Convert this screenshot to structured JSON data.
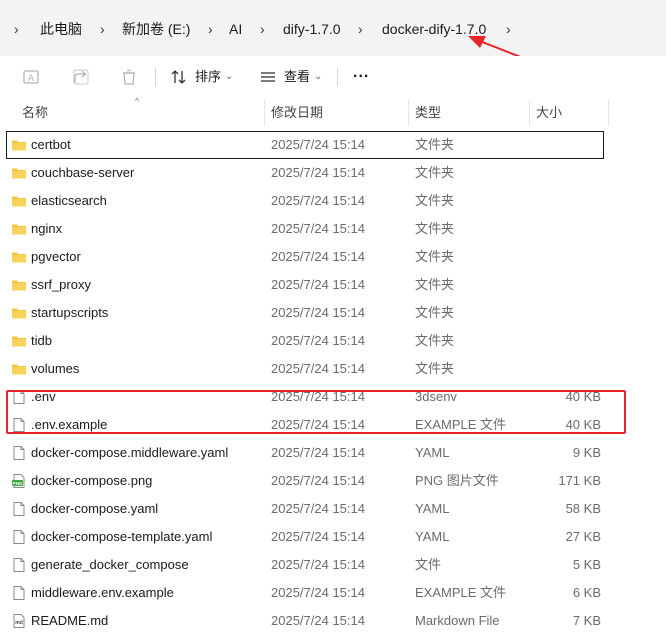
{
  "breadcrumb": {
    "items": [
      "此电脑",
      "新加卷 (E:)",
      "AI",
      "dify-1.7.0",
      "docker-dify-1.7.0"
    ]
  },
  "toolbar": {
    "sort_label": "排序",
    "view_label": "查看",
    "more_label": "..."
  },
  "columns": {
    "name": "名称",
    "date": "修改日期",
    "type": "类型",
    "size": "大小"
  },
  "files": [
    {
      "name": "certbot",
      "date": "2025/7/24 15:14",
      "type": "文件夹",
      "size": "",
      "icon": "folder-icon"
    },
    {
      "name": "couchbase-server",
      "date": "2025/7/24 15:14",
      "type": "文件夹",
      "size": "",
      "icon": "folder-icon"
    },
    {
      "name": "elasticsearch",
      "date": "2025/7/24 15:14",
      "type": "文件夹",
      "size": "",
      "icon": "folder-icon"
    },
    {
      "name": "nginx",
      "date": "2025/7/24 15:14",
      "type": "文件夹",
      "size": "",
      "icon": "folder-icon"
    },
    {
      "name": "pgvector",
      "date": "2025/7/24 15:14",
      "type": "文件夹",
      "size": "",
      "icon": "folder-icon"
    },
    {
      "name": "ssrf_proxy",
      "date": "2025/7/24 15:14",
      "type": "文件夹",
      "size": "",
      "icon": "folder-icon"
    },
    {
      "name": "startupscripts",
      "date": "2025/7/24 15:14",
      "type": "文件夹",
      "size": "",
      "icon": "folder-icon"
    },
    {
      "name": "tidb",
      "date": "2025/7/24 15:14",
      "type": "文件夹",
      "size": "",
      "icon": "folder-icon"
    },
    {
      "name": "volumes",
      "date": "2025/7/24 15:14",
      "type": "文件夹",
      "size": "",
      "icon": "folder-icon"
    },
    {
      "name": ".env",
      "date": "2025/7/24 15:14",
      "type": "3dsenv",
      "size": "40 KB",
      "icon": "file-icon"
    },
    {
      "name": ".env.example",
      "date": "2025/7/24 15:14",
      "type": "EXAMPLE 文件",
      "size": "40 KB",
      "icon": "file-icon"
    },
    {
      "name": "docker-compose.middleware.yaml",
      "date": "2025/7/24 15:14",
      "type": "YAML",
      "size": "9 KB",
      "icon": "file-icon"
    },
    {
      "name": "docker-compose.png",
      "date": "2025/7/24 15:14",
      "type": "PNG 图片文件",
      "size": "171 KB",
      "icon": "png-icon"
    },
    {
      "name": "docker-compose.yaml",
      "date": "2025/7/24 15:14",
      "type": "YAML",
      "size": "58 KB",
      "icon": "file-icon"
    },
    {
      "name": "docker-compose-template.yaml",
      "date": "2025/7/24 15:14",
      "type": "YAML",
      "size": "27 KB",
      "icon": "file-icon"
    },
    {
      "name": "generate_docker_compose",
      "date": "2025/7/24 15:14",
      "type": "文件",
      "size": "5 KB",
      "icon": "file-icon"
    },
    {
      "name": "middleware.env.example",
      "date": "2025/7/24 15:14",
      "type": "EXAMPLE 文件",
      "size": "6 KB",
      "icon": "file-icon"
    },
    {
      "name": "README.md",
      "date": "2025/7/24 15:14",
      "type": "Markdown File",
      "size": "7 KB",
      "icon": "md-icon"
    }
  ],
  "colors": {
    "annotation": "#e8262a",
    "folder": "#f4c542",
    "selection_border": "#1a1a1a"
  }
}
